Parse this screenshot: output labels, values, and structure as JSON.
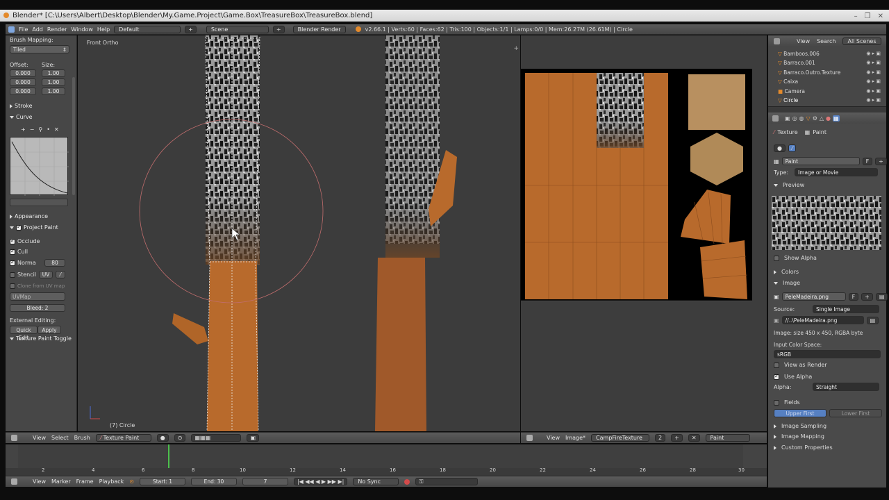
{
  "window": {
    "title": "Blender* [C:\\Users\\Albert\\Desktop\\Blender\\My.Game.Project\\Game.Box\\TreasureBox\\TreasureBox.blend]",
    "controls": [
      "–",
      "❐",
      "✕"
    ]
  },
  "info_header": {
    "menus": [
      "File",
      "Add",
      "Render",
      "Window",
      "Help"
    ],
    "layout": "Default",
    "scene": "Scene",
    "engine": "Blender Render",
    "stats": "v2.66.1 | Verts:60 | Faces:62 | Tris:100 | Objects:1/1 | Lamps:0/0 | Mem:26.27M (26.61M) | Circle"
  },
  "tool_panel": {
    "brush_mapping_label": "Brush Mapping:",
    "brush_mapping_value": "Tiled",
    "offset_label": "Offset:",
    "size_label": "Size:",
    "offset": [
      "0.000",
      "0.000",
      "0.000"
    ],
    "size": [
      "1.00",
      "1.00",
      "1.00"
    ],
    "stroke_label": "Stroke",
    "curve_label": "Curve",
    "appearance_label": "Appearance",
    "project_paint_label": "Project Paint",
    "occlude_label": "Occlude",
    "cull_label": "Cull",
    "normal_label": "Norma",
    "normal_value": "80",
    "stencil_label": "Stencil",
    "stencil_uv": "UV",
    "clone_label": "Clone from UV map",
    "uvmap_value": "UVMap",
    "bleed_value": "Bleed: 2",
    "external_edit_label": "External Editing:",
    "quick_edit_label": "Quick Edit",
    "apply_label": "Apply",
    "texture_paint_toggle_label": "Texture Paint Toggle"
  },
  "viewport": {
    "view_label": "Front Ortho",
    "object_label": "(7) Circle",
    "header": {
      "menus": [
        "View",
        "Select",
        "Brush"
      ],
      "mode": "Texture Paint"
    }
  },
  "uv_editor": {
    "header": {
      "menus": [
        "View",
        "Image*"
      ],
      "image_name": "CampFireTexture",
      "users": "2",
      "mode": "Paint"
    }
  },
  "outliner": {
    "tabs": [
      "View",
      "Search",
      "All Scenes"
    ],
    "items": [
      "Bamboos.006",
      "Barraco.001",
      "Barraco.Outro.Texture",
      "Caixa",
      "Camera",
      "Circle"
    ]
  },
  "properties": {
    "breadcrumb_texture": "Texture",
    "breadcrumb_paint": "Paint",
    "texture_name": "Paint",
    "type_label": "Type:",
    "type_value": "Image or Movie",
    "preview_label": "Preview",
    "show_alpha_label": "Show Alpha",
    "colors_label": "Colors",
    "image_label": "Image",
    "image_name": "PeleMadeira.png",
    "source_label": "Source:",
    "source_value": "Single Image",
    "filepath": "//..\\PeleMadeira.png",
    "image_info": "Image: size 450 x 450, RGBA byte",
    "input_color_space_label": "Input Color Space:",
    "color_space_value": "sRGB",
    "view_as_render_label": "View as Render",
    "use_alpha_label": "Use Alpha",
    "alpha_label": "Alpha:",
    "alpha_value": "Straight",
    "fields_label": "Fields",
    "upper_first_label": "Upper First",
    "lower_first_label": "Lower First",
    "image_sampling_label": "Image Sampling",
    "image_mapping_label": "Image Mapping",
    "custom_properties_label": "Custom Properties"
  },
  "timeline": {
    "ticks": [
      "2",
      "4",
      "6",
      "8",
      "10",
      "12",
      "14",
      "16",
      "18",
      "20",
      "22",
      "24",
      "26",
      "28",
      "30"
    ],
    "current_frame_marker": 7,
    "header": {
      "menus": [
        "View",
        "Marker",
        "Frame",
        "Playback"
      ],
      "start": "Start: 1",
      "end": "End: 30",
      "current": "7",
      "sync": "No Sync"
    }
  },
  "colors": {
    "wood_orange": "#b86a2c",
    "panel_grey": "#474747",
    "viewport_grey": "#3c3c3c",
    "selection_blue": "#5680c2",
    "accent_orange": "#e48a2b"
  }
}
